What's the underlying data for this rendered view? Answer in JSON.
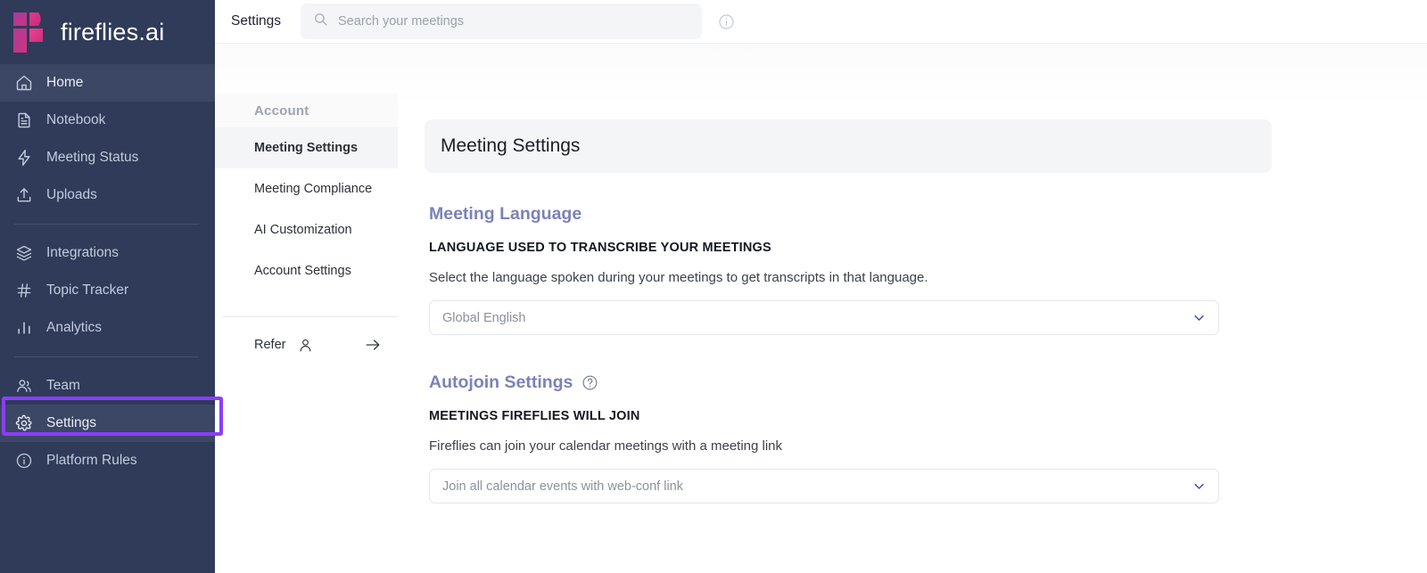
{
  "brand": {
    "name": "fireflies.ai",
    "logo_icon": "fireflies-logo-icon"
  },
  "colors": {
    "sidebar_bg": "#2f3b59",
    "sidebar_active": "#3b4764",
    "highlight_purple": "#8b3dff",
    "section_heading": "#7b82b8",
    "logo_pink": "#e0398a",
    "logo_magenta": "#c72a7d",
    "logo_purple": "#8e3f9e"
  },
  "sidebar": {
    "groups": [
      {
        "items": [
          {
            "label": "Home",
            "icon": "home-icon",
            "active": true
          },
          {
            "label": "Notebook",
            "icon": "notebook-icon",
            "active": false
          },
          {
            "label": "Meeting Status",
            "icon": "lightning-icon",
            "active": false
          },
          {
            "label": "Uploads",
            "icon": "upload-icon",
            "active": false
          }
        ]
      },
      {
        "items": [
          {
            "label": "Integrations",
            "icon": "layers-icon",
            "active": false
          },
          {
            "label": "Topic Tracker",
            "icon": "hash-icon",
            "active": false
          },
          {
            "label": "Analytics",
            "icon": "bar-chart-icon",
            "active": false
          }
        ]
      },
      {
        "items": [
          {
            "label": "Team",
            "icon": "people-icon",
            "active": false
          },
          {
            "label": "Settings",
            "icon": "gear-icon",
            "active": true,
            "highlighted": true
          },
          {
            "label": "Platform Rules",
            "icon": "info-circle-icon",
            "active": false
          }
        ]
      }
    ]
  },
  "topbar": {
    "title": "Settings",
    "search": {
      "placeholder": "Search your meetings",
      "value": "",
      "icon": "search-icon"
    },
    "info_icon": "info-circle-icon"
  },
  "settings_nav": {
    "group_header": "Account",
    "items": [
      {
        "label": "Meeting Settings",
        "selected": true
      },
      {
        "label": "Meeting Compliance",
        "selected": false
      },
      {
        "label": "AI Customization",
        "selected": false
      },
      {
        "label": "Account Settings",
        "selected": false
      }
    ],
    "refer": {
      "label": "Refer",
      "person_icon": "person-icon",
      "arrow_icon": "arrow-right-icon"
    }
  },
  "main": {
    "panel_title": "Meeting Settings",
    "sections": [
      {
        "heading": "Meeting Language",
        "has_help_icon": false,
        "label": "LANGUAGE USED TO TRANSCRIBE YOUR MEETINGS",
        "description": "Select the language spoken during your meetings to get transcripts in that language.",
        "select_value": "Global English",
        "chevron_icon": "chevron-down-icon"
      },
      {
        "heading": "Autojoin Settings",
        "has_help_icon": true,
        "help_icon": "question-circle-icon",
        "label": "MEETINGS FIREFLIES WILL JOIN",
        "description": "Fireflies can join your calendar meetings with a meeting link",
        "select_value": "Join all calendar events with web-conf link",
        "chevron_icon": "chevron-down-icon"
      }
    ]
  }
}
